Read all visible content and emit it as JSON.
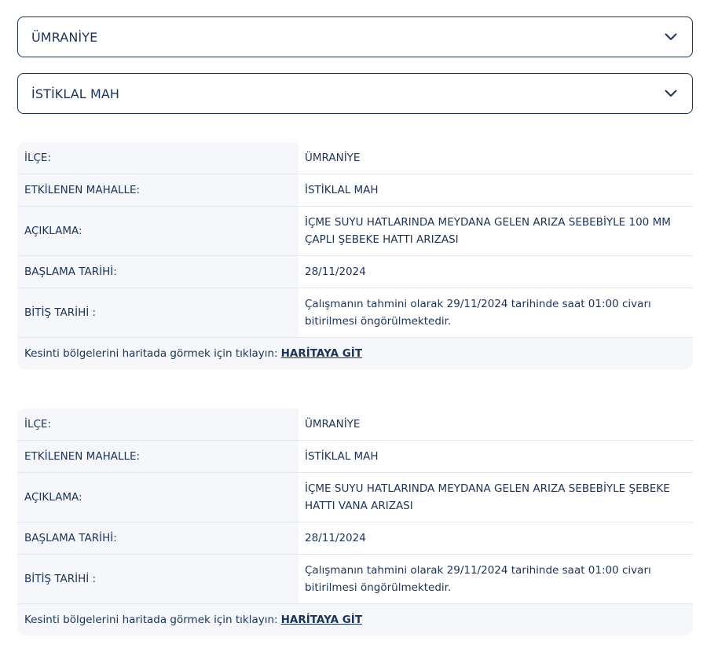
{
  "filters": {
    "district": "ÜMRANİYE",
    "neighborhood": "İSTİKLAL MAH"
  },
  "outages": [
    {
      "district_label": "İLÇE:",
      "district_value": "ÜMRANİYE",
      "neighborhood_label": "ETKİLENEN MAHALLE:",
      "neighborhood_value": "İSTİKLAL MAH",
      "description_label": "AÇIKLAMA:",
      "description_line1": "İÇME SUYU HATLARINDA MEYDANA GELEN ARIZA SEBEBİYLE 100 MM",
      "description_line2": "ÇAPLI ŞEBEKE HATTI ARIZASI",
      "start_label": "BAŞLAMA TARİHİ:",
      "start_value": "28/11/2024",
      "end_label": "BİTİŞ TARİHİ :",
      "end_line1": "Çalışmanın tahmini olarak 29/11/2024 tarihinde saat 01:00 civarı",
      "end_line2": "bitirilmesi öngörülmektedir.",
      "map_prompt": "Kesinti bölgelerini haritada görmek için tıklayın:",
      "map_link": "HARİTAYA GİT"
    },
    {
      "district_label": "İLÇE:",
      "district_value": "ÜMRANİYE",
      "neighborhood_label": "ETKİLENEN MAHALLE:",
      "neighborhood_value": "İSTİKLAL MAH",
      "description_label": "AÇIKLAMA:",
      "description_line1": "İÇME SUYU HATLARINDA MEYDANA GELEN ARIZA SEBEBİYLE ŞEBEKE",
      "description_line2": "HATTI VANA ARIZASI",
      "start_label": "BAŞLAMA TARİHİ:",
      "start_value": "28/11/2024",
      "end_label": "BİTİŞ TARİHİ :",
      "end_line1": "Çalışmanın tahmini olarak 29/11/2024 tarihinde saat 01:00 civarı",
      "end_line2": "bitirilmesi öngörülmektedir.",
      "map_prompt": "Kesinti bölgelerini haritada görmek için tıklayın:",
      "map_link": "HARİTAYA GİT"
    }
  ],
  "icons": {
    "dropdown": "chevron-down-icon"
  },
  "colors": {
    "text": "#1b3358",
    "card_bg": "#f5f7fb",
    "border": "#1b3358"
  }
}
